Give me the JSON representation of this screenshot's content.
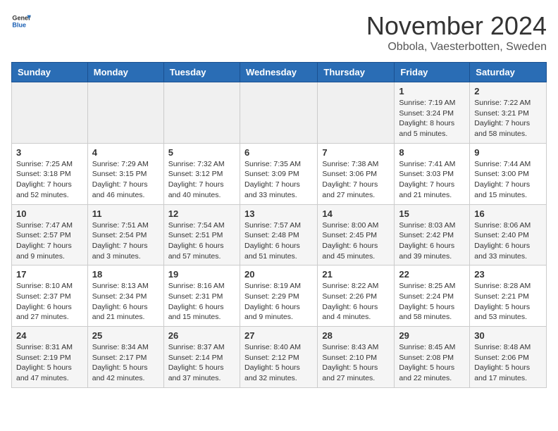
{
  "logo": {
    "general": "General",
    "blue": "Blue"
  },
  "header": {
    "month": "November 2024",
    "location": "Obbola, Vaesterbotten, Sweden"
  },
  "weekdays": [
    "Sunday",
    "Monday",
    "Tuesday",
    "Wednesday",
    "Thursday",
    "Friday",
    "Saturday"
  ],
  "weeks": [
    [
      {
        "day": "",
        "info": ""
      },
      {
        "day": "",
        "info": ""
      },
      {
        "day": "",
        "info": ""
      },
      {
        "day": "",
        "info": ""
      },
      {
        "day": "",
        "info": ""
      },
      {
        "day": "1",
        "info": "Sunrise: 7:19 AM\nSunset: 3:24 PM\nDaylight: 8 hours\nand 5 minutes."
      },
      {
        "day": "2",
        "info": "Sunrise: 7:22 AM\nSunset: 3:21 PM\nDaylight: 7 hours\nand 58 minutes."
      }
    ],
    [
      {
        "day": "3",
        "info": "Sunrise: 7:25 AM\nSunset: 3:18 PM\nDaylight: 7 hours\nand 52 minutes."
      },
      {
        "day": "4",
        "info": "Sunrise: 7:29 AM\nSunset: 3:15 PM\nDaylight: 7 hours\nand 46 minutes."
      },
      {
        "day": "5",
        "info": "Sunrise: 7:32 AM\nSunset: 3:12 PM\nDaylight: 7 hours\nand 40 minutes."
      },
      {
        "day": "6",
        "info": "Sunrise: 7:35 AM\nSunset: 3:09 PM\nDaylight: 7 hours\nand 33 minutes."
      },
      {
        "day": "7",
        "info": "Sunrise: 7:38 AM\nSunset: 3:06 PM\nDaylight: 7 hours\nand 27 minutes."
      },
      {
        "day": "8",
        "info": "Sunrise: 7:41 AM\nSunset: 3:03 PM\nDaylight: 7 hours\nand 21 minutes."
      },
      {
        "day": "9",
        "info": "Sunrise: 7:44 AM\nSunset: 3:00 PM\nDaylight: 7 hours\nand 15 minutes."
      }
    ],
    [
      {
        "day": "10",
        "info": "Sunrise: 7:47 AM\nSunset: 2:57 PM\nDaylight: 7 hours\nand 9 minutes."
      },
      {
        "day": "11",
        "info": "Sunrise: 7:51 AM\nSunset: 2:54 PM\nDaylight: 7 hours\nand 3 minutes."
      },
      {
        "day": "12",
        "info": "Sunrise: 7:54 AM\nSunset: 2:51 PM\nDaylight: 6 hours\nand 57 minutes."
      },
      {
        "day": "13",
        "info": "Sunrise: 7:57 AM\nSunset: 2:48 PM\nDaylight: 6 hours\nand 51 minutes."
      },
      {
        "day": "14",
        "info": "Sunrise: 8:00 AM\nSunset: 2:45 PM\nDaylight: 6 hours\nand 45 minutes."
      },
      {
        "day": "15",
        "info": "Sunrise: 8:03 AM\nSunset: 2:42 PM\nDaylight: 6 hours\nand 39 minutes."
      },
      {
        "day": "16",
        "info": "Sunrise: 8:06 AM\nSunset: 2:40 PM\nDaylight: 6 hours\nand 33 minutes."
      }
    ],
    [
      {
        "day": "17",
        "info": "Sunrise: 8:10 AM\nSunset: 2:37 PM\nDaylight: 6 hours\nand 27 minutes."
      },
      {
        "day": "18",
        "info": "Sunrise: 8:13 AM\nSunset: 2:34 PM\nDaylight: 6 hours\nand 21 minutes."
      },
      {
        "day": "19",
        "info": "Sunrise: 8:16 AM\nSunset: 2:31 PM\nDaylight: 6 hours\nand 15 minutes."
      },
      {
        "day": "20",
        "info": "Sunrise: 8:19 AM\nSunset: 2:29 PM\nDaylight: 6 hours\nand 9 minutes."
      },
      {
        "day": "21",
        "info": "Sunrise: 8:22 AM\nSunset: 2:26 PM\nDaylight: 6 hours\nand 4 minutes."
      },
      {
        "day": "22",
        "info": "Sunrise: 8:25 AM\nSunset: 2:24 PM\nDaylight: 5 hours\nand 58 minutes."
      },
      {
        "day": "23",
        "info": "Sunrise: 8:28 AM\nSunset: 2:21 PM\nDaylight: 5 hours\nand 53 minutes."
      }
    ],
    [
      {
        "day": "24",
        "info": "Sunrise: 8:31 AM\nSunset: 2:19 PM\nDaylight: 5 hours\nand 47 minutes."
      },
      {
        "day": "25",
        "info": "Sunrise: 8:34 AM\nSunset: 2:17 PM\nDaylight: 5 hours\nand 42 minutes."
      },
      {
        "day": "26",
        "info": "Sunrise: 8:37 AM\nSunset: 2:14 PM\nDaylight: 5 hours\nand 37 minutes."
      },
      {
        "day": "27",
        "info": "Sunrise: 8:40 AM\nSunset: 2:12 PM\nDaylight: 5 hours\nand 32 minutes."
      },
      {
        "day": "28",
        "info": "Sunrise: 8:43 AM\nSunset: 2:10 PM\nDaylight: 5 hours\nand 27 minutes."
      },
      {
        "day": "29",
        "info": "Sunrise: 8:45 AM\nSunset: 2:08 PM\nDaylight: 5 hours\nand 22 minutes."
      },
      {
        "day": "30",
        "info": "Sunrise: 8:48 AM\nSunset: 2:06 PM\nDaylight: 5 hours\nand 17 minutes."
      }
    ]
  ]
}
